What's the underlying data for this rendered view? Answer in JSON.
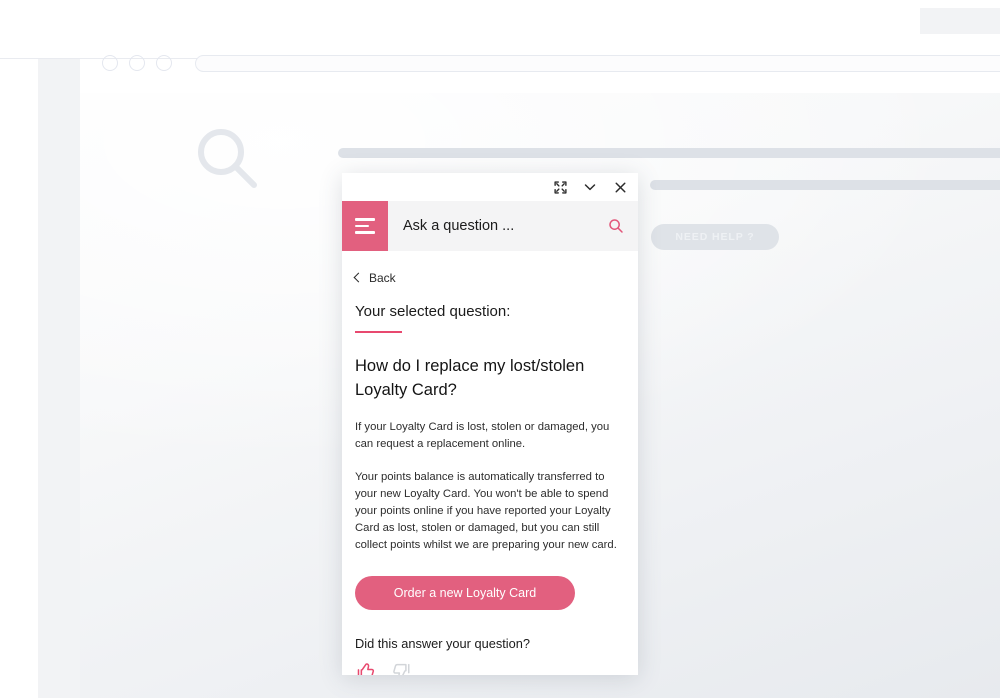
{
  "browser": {
    "traffic_lights": [
      "dot-1",
      "dot-2",
      "dot-3"
    ],
    "url_value": "",
    "url_placeholder": ""
  },
  "page": {
    "search_icon": "search-icon",
    "placeholder_bars": 2,
    "need_help_label": "NEED HELP ?"
  },
  "widget": {
    "titlebar": {
      "expand_icon": "expand-icon",
      "minimize_icon": "chevron-down-icon",
      "close_icon": "close-icon"
    },
    "header": {
      "menu_icon": "hamburger-menu-icon",
      "title": "Ask a question ...",
      "search_icon": "search-icon"
    },
    "back_label": "Back",
    "section_label": "Your selected question:",
    "question_title": "How do I replace my lost/stolen Loyalty Card?",
    "answer_paragraphs": [
      "If your Loyalty Card is lost, stolen or damaged, you can request a replacement online.",
      "Your points balance is automatically transferred to your new Loyalty Card. You won't be able to spend your points online if you have reported your Loyalty Card as lost, stolen or damaged, but you can still collect points whilst we are preparing your new card."
    ],
    "cta_label": "Order a new Loyalty Card",
    "feedback_question": "Did this answer your question?",
    "feedback_positive_icon": "thumbs-up-icon",
    "feedback_negative_icon": "thumbs-down-icon"
  },
  "colors": {
    "accent_pink": "#e2607f",
    "accent_pink_dark": "#e8496f",
    "page_bg": "#e8eaed",
    "shell_bg": "#f2f3f5",
    "widget_header_bg": "#f4f4f5",
    "ghost_gray": "#dde1e7",
    "thumb_down_gray": "#d2d5d9"
  }
}
